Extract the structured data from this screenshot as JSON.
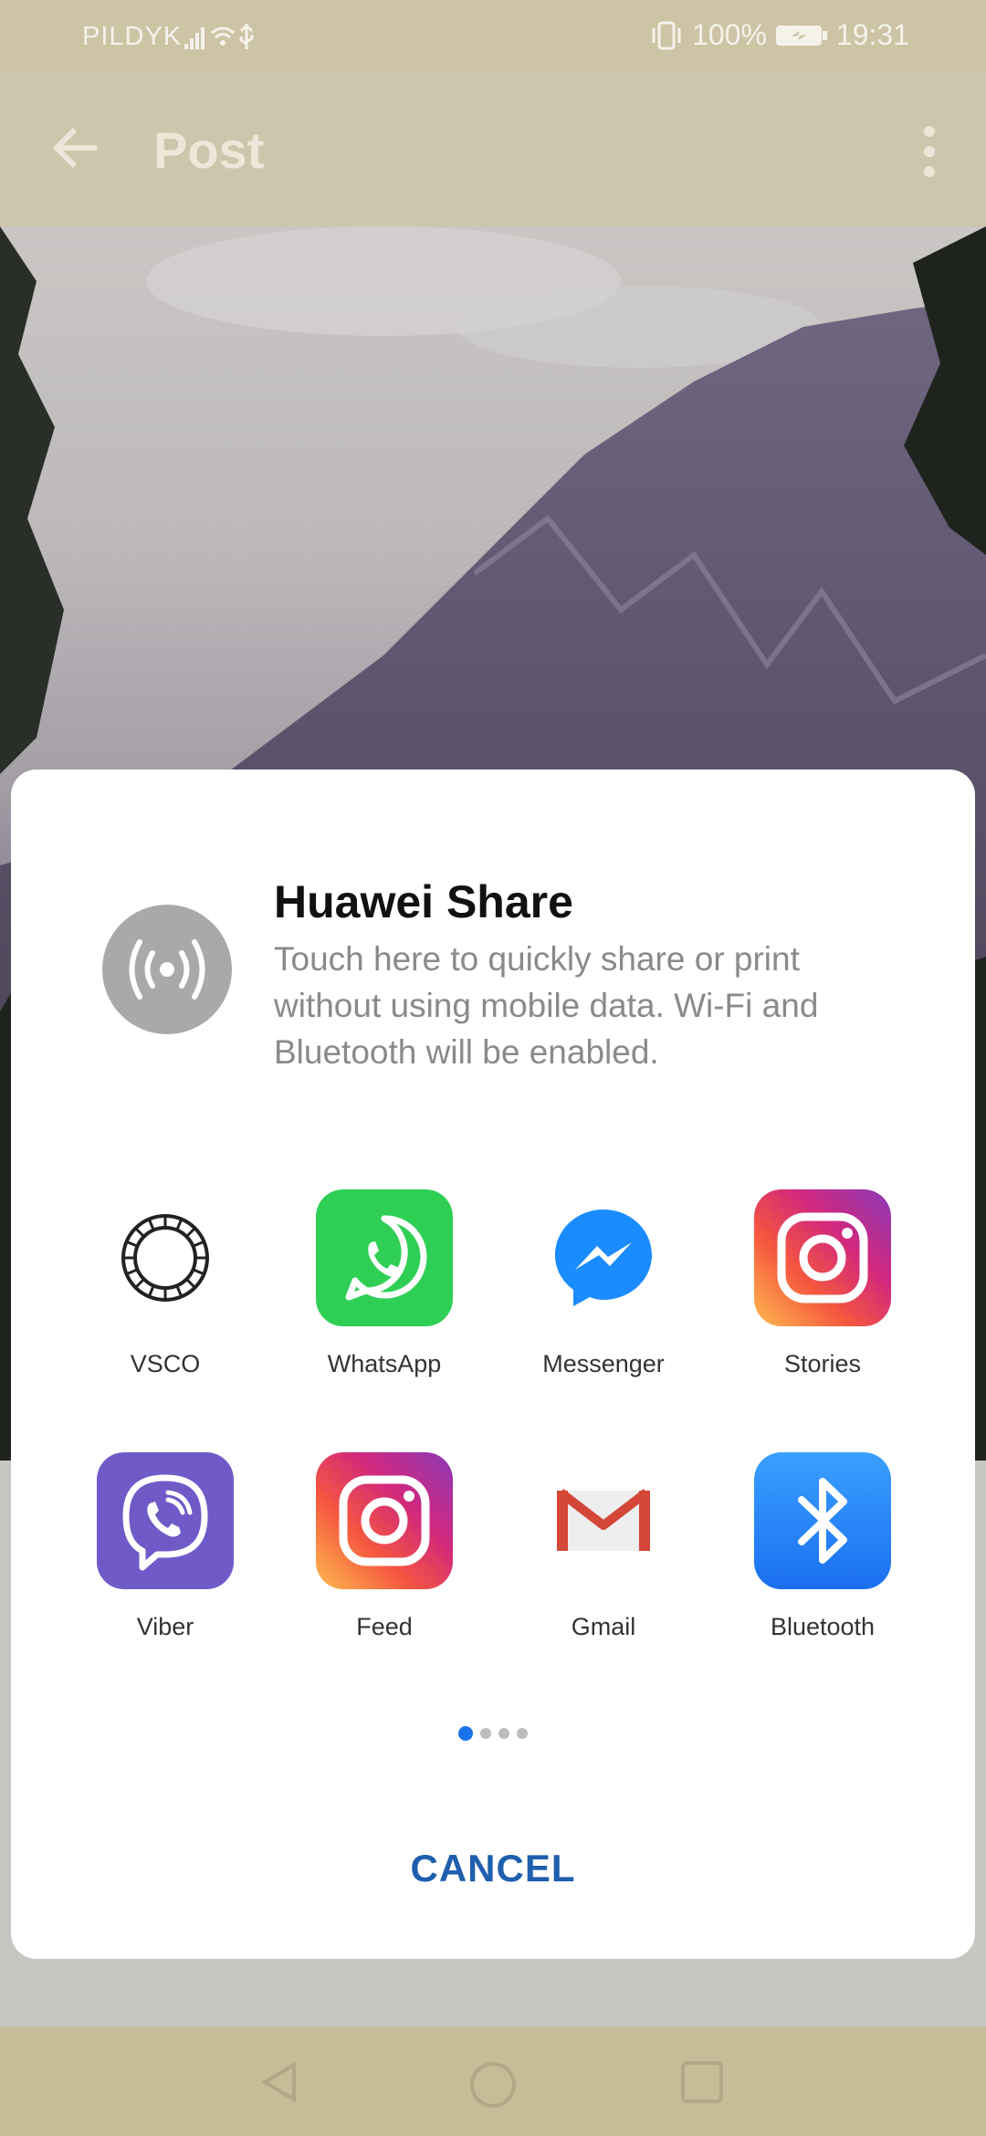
{
  "status_bar": {
    "carrier": "PILDYK",
    "battery": "100%",
    "time": "19:31"
  },
  "app_bar": {
    "title": "Post"
  },
  "share": {
    "huawei_share_title": "Huawei Share",
    "huawei_share_desc": "Touch here to quickly share or print without using mobile data. Wi-Fi and Bluetooth will be enabled.",
    "apps_row1": [
      {
        "label": "VSCO",
        "icon": "vsco-icon"
      },
      {
        "label": "WhatsApp",
        "icon": "whatsapp-icon"
      },
      {
        "label": "Messenger",
        "icon": "messenger-icon"
      },
      {
        "label": "Stories",
        "icon": "instagram-icon"
      }
    ],
    "apps_row2": [
      {
        "label": "Viber",
        "icon": "viber-icon"
      },
      {
        "label": "Feed",
        "icon": "instagram-icon"
      },
      {
        "label": "Gmail",
        "icon": "gmail-icon"
      },
      {
        "label": "Bluetooth",
        "icon": "bluetooth-icon"
      }
    ],
    "page_indicator": {
      "current": 1,
      "total": 4
    },
    "cancel_label": "CANCEL"
  },
  "colors": {
    "accent": "#1f5fae",
    "indicator_active": "#1a73e8",
    "whatsapp": "#25d366",
    "messenger": "#1a8cff",
    "viber": "#7360f2",
    "bluetooth": "#1e88ff"
  }
}
